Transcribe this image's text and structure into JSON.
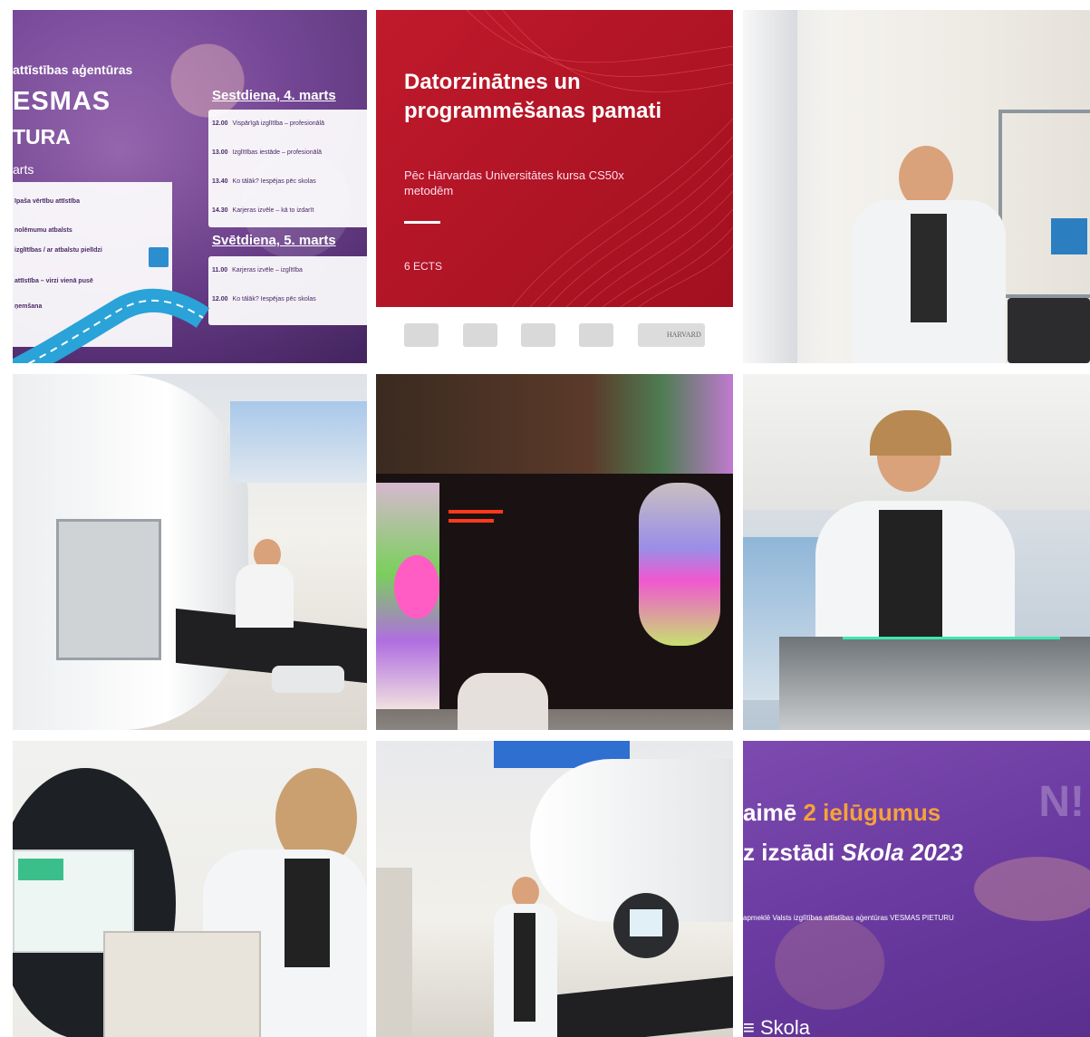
{
  "tile1": {
    "header_line1": "attīstības aģentūras",
    "header_line2": "ESMAS",
    "header_line3": "TURA",
    "header_line4": "arts",
    "left_rows": [
      "īpaša vērtību attīstība",
      "nolēmumu atbalsts",
      "izglītības / ar atbalstu pielīdzi",
      "attīstība – virzi vienā pusē",
      "ņemšana"
    ],
    "day1": "Sestdiena, 4. marts",
    "day1_rows": [
      {
        "time": "12.00",
        "text": "Vispārīgā izglītība – profesionālā"
      },
      {
        "time": "13.00",
        "text": "Izglītības iestāde – profesionālā"
      },
      {
        "time": "13.40",
        "text": "Ko tālāk? Iespējas pēc skolas"
      },
      {
        "time": "14.30",
        "text": "Karjeras izvēle – kā to izdarīt"
      }
    ],
    "day2": "Svētdiena, 5. marts",
    "day2_rows": [
      {
        "time": "11.00",
        "text": "Karjeras izvēle – izglītība"
      },
      {
        "time": "12.00",
        "text": "Ko tālāk? Iespējas pēc skolas"
      }
    ]
  },
  "tile2": {
    "title": "Datorzinātnes un programmēšanas pamati",
    "subtitle": "Pēc Hārvardas Universitātes kursa CS50x metodēm",
    "ects": "6 ECTS",
    "logos": [
      "university-seal-1",
      "university-seal-2",
      "rbs-logo",
      "university-seal-3",
      "harvard-logo"
    ],
    "harvard_text": "HARVARD"
  },
  "tile9": {
    "line1_pre": "aimē ",
    "line1_highlight": "2 ielūgumus",
    "line2_pre": "z izstādi ",
    "line2_em": "Skola 2023",
    "line3": "apmeklē Valsts izglītības attīstības aģentūras VESMAS PIETURU",
    "brand": "Skola"
  },
  "colors": {
    "red": "#c01a2c",
    "purple": "#6f3e93",
    "orange_highlight": "#f6a23a"
  }
}
